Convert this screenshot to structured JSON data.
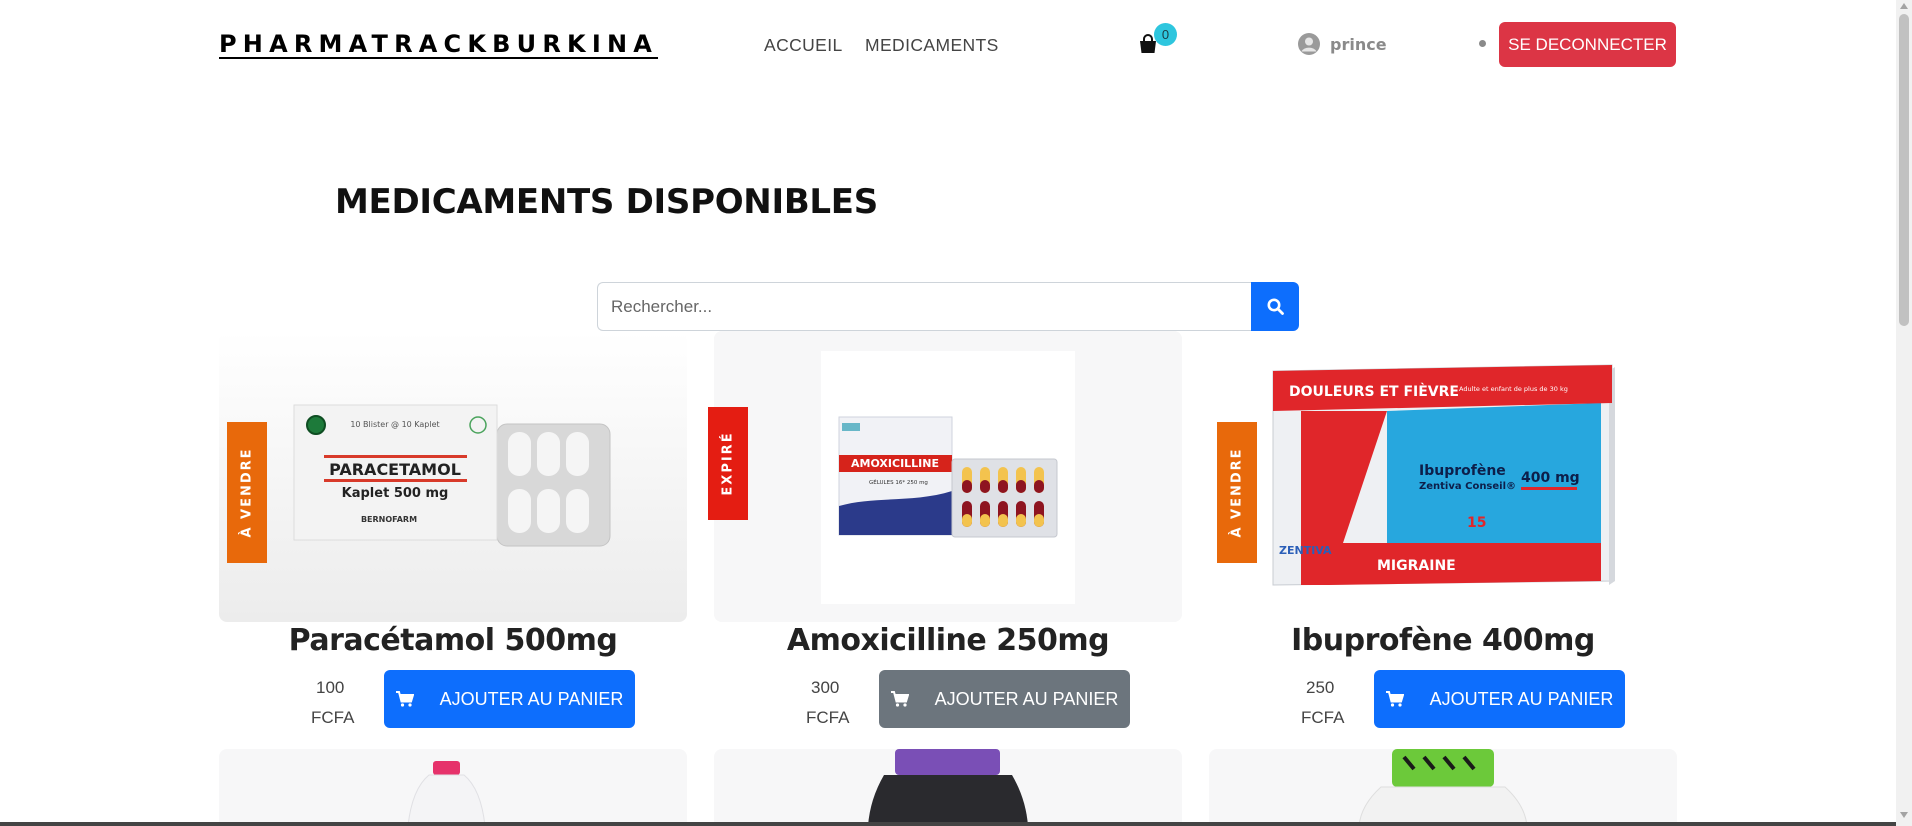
{
  "navbar": {
    "brand": "PHARMATRACKBURKINA",
    "links": [
      "ACCUEIL",
      "MEDICAMENTS"
    ],
    "cart_count": "0",
    "user_name": "prince",
    "logout_label": "SE DECONNECTER"
  },
  "main": {
    "title": "MEDICAMENTS DISPONIBLES",
    "search_placeholder": "Rechercher..."
  },
  "products": [
    {
      "name": "Paracétamol 500mg",
      "status": "À VENDRE",
      "price": "100",
      "currency": "FCFA",
      "button": "AJOUTER AU PANIER",
      "button_color": "#0d6efd",
      "ribbon_color": "#e8690b"
    },
    {
      "name": "Amoxicilline 250mg",
      "status": "EXPIRÉ",
      "price": "300",
      "currency": "FCFA",
      "button": "AJOUTER AU PANIER",
      "button_color": "#6c757d",
      "ribbon_color": "#e41d12"
    },
    {
      "name": "Ibuprofène 400mg",
      "status": "À VENDRE",
      "price": "250",
      "currency": "FCFA",
      "button": "AJOUTER AU PANIER",
      "button_color": "#0d6efd",
      "ribbon_color": "#e8690b"
    }
  ],
  "package_text": {
    "paracetamol": {
      "top": "10 Blister @ 10 Kaplet",
      "name": "PARACETAMOL",
      "dose": "Kaplet 500 mg",
      "maker": "BERNOFARM"
    },
    "amoxicilline": {
      "name": "AMOXICILLINE",
      "sub": "GÉLULES 16* 250 mg"
    },
    "ibuprofene": {
      "banner": "DOULEURS ET FIÈVRE",
      "note": "Adulte et enfant de plus de 30 kg",
      "name": "Ibuprofène",
      "brand_line": "Zentiva Conseil®",
      "dose": "400 mg",
      "count": "15",
      "maker": "ZENTIVA",
      "footer": "MIGRAINE"
    }
  },
  "icons": [
    "user-icon",
    "cart-icon",
    "search-icon",
    "cart-icon"
  ]
}
